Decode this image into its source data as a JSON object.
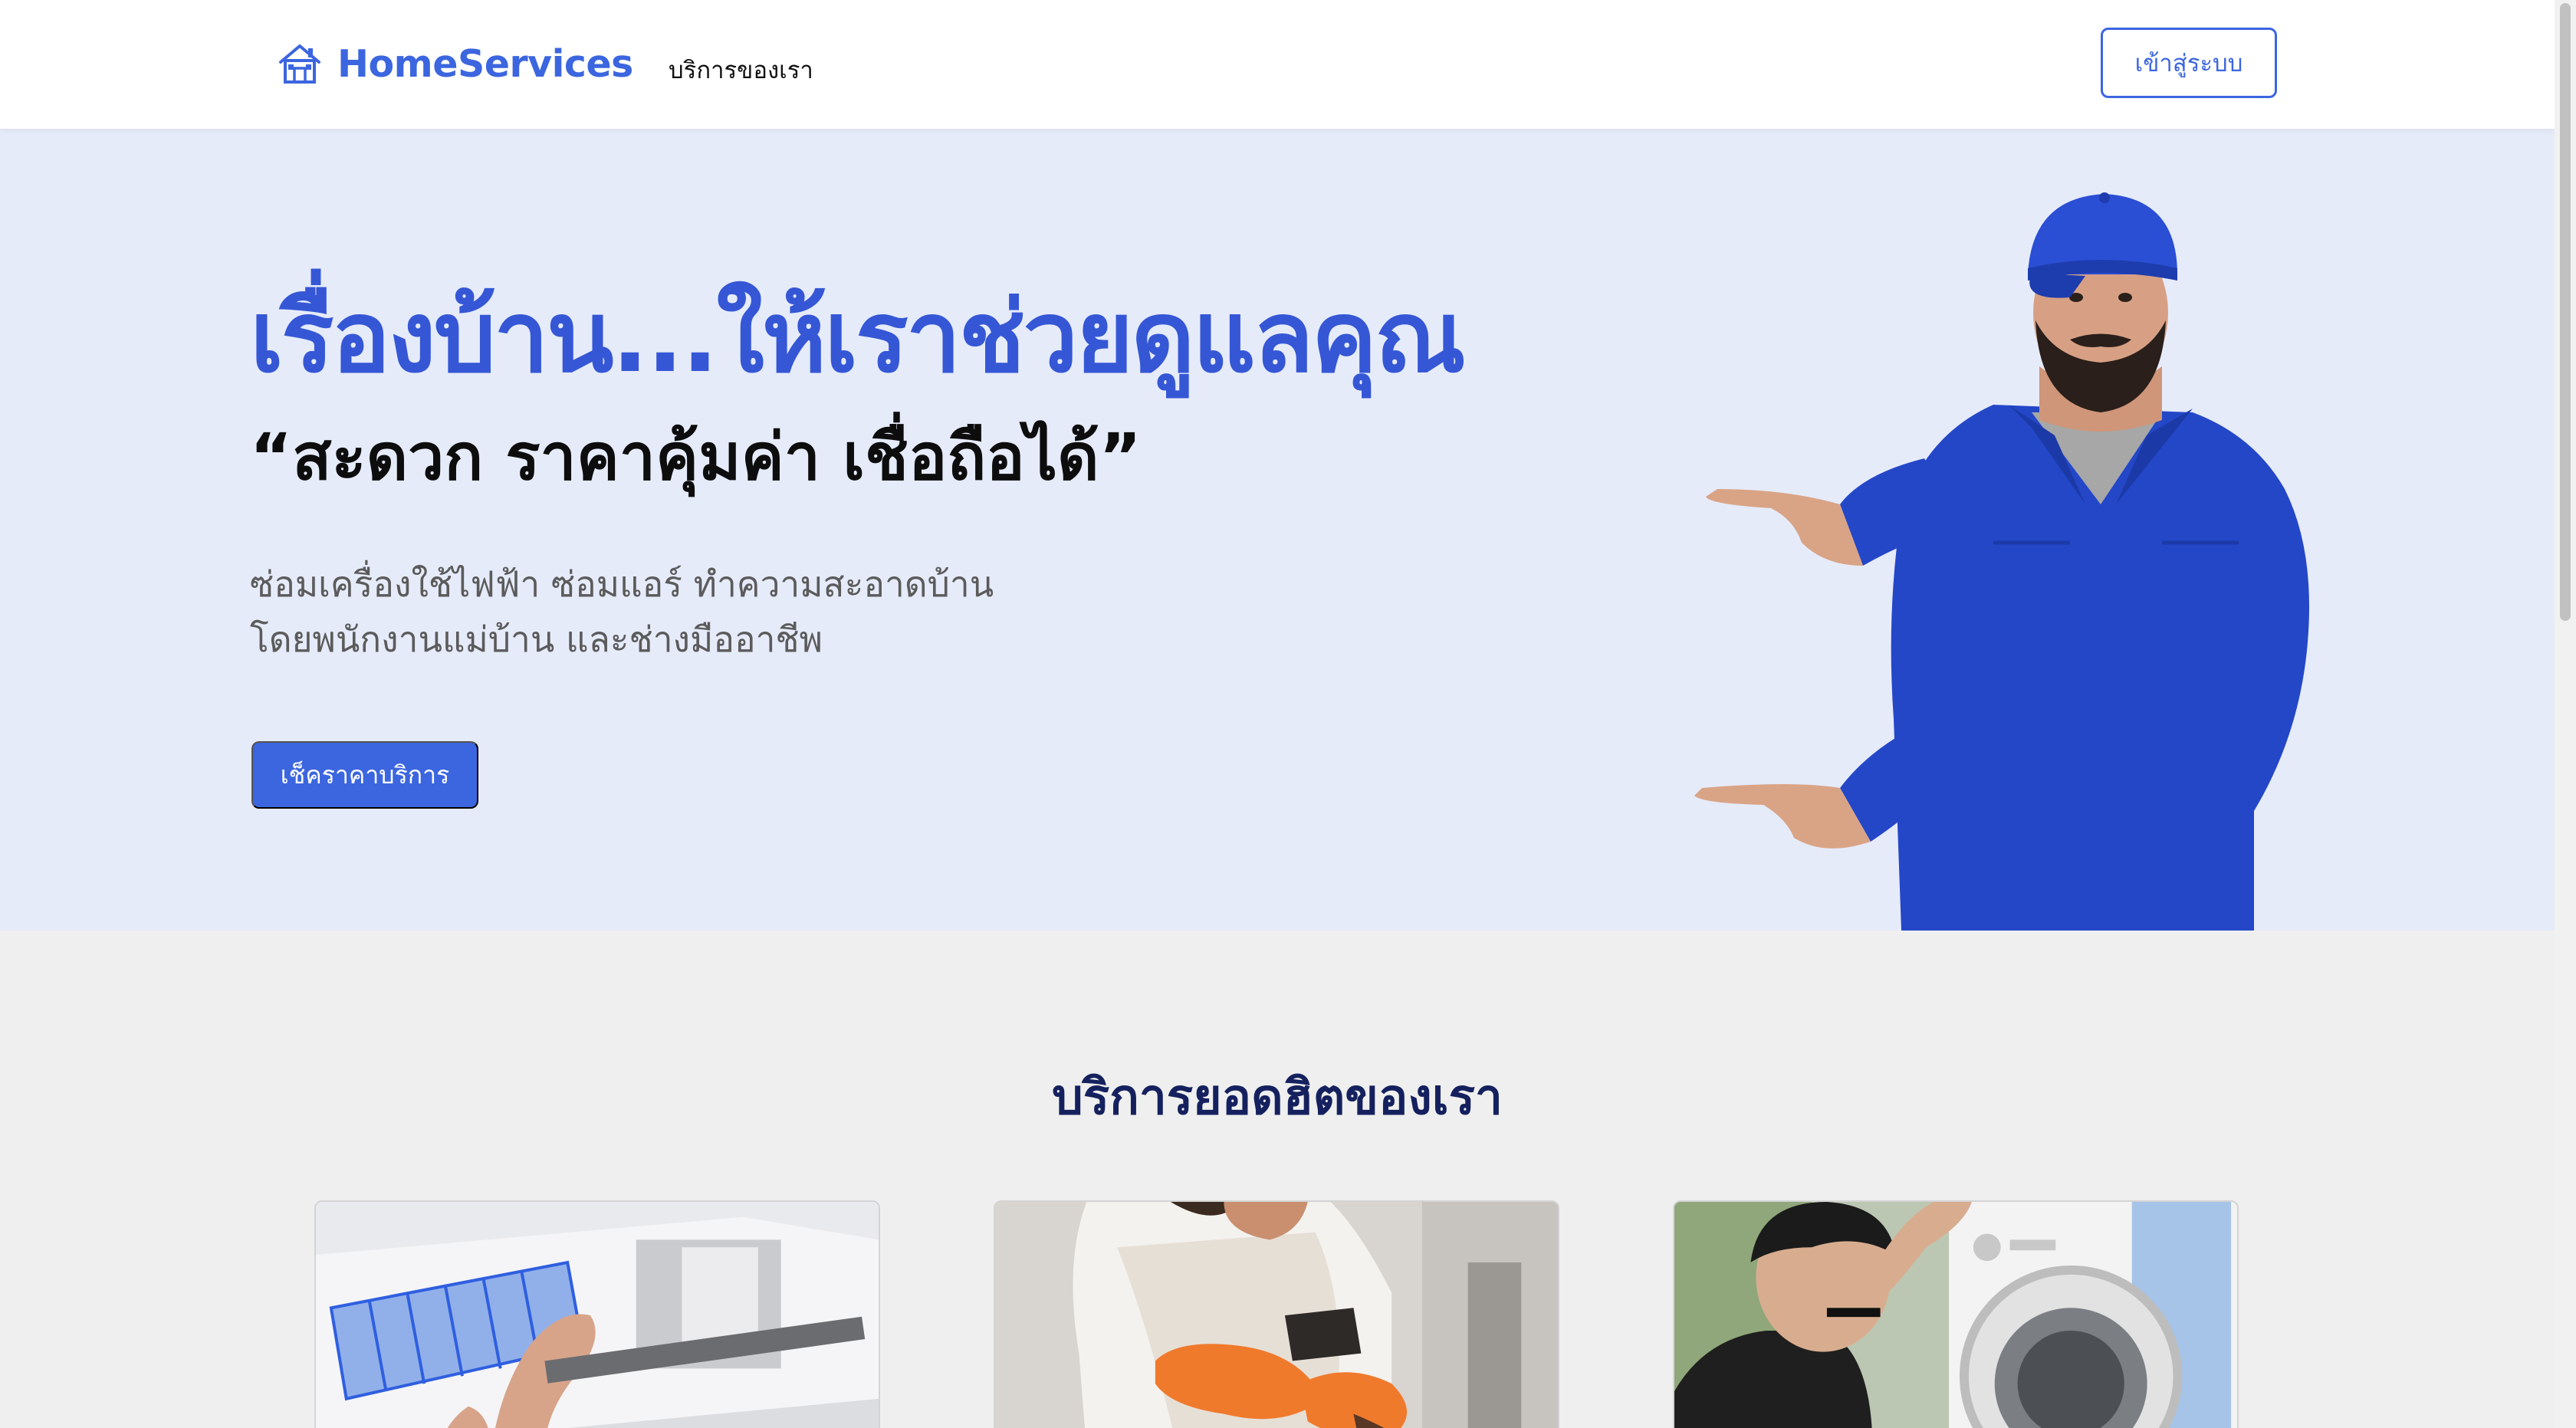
{
  "navbar": {
    "brand": "HomeServices",
    "brand_icon": "home-icon",
    "links": [
      "บริการของเรา"
    ],
    "login_label": "เข้าสู่ระบบ"
  },
  "hero": {
    "title": "เรื่องบ้าน...ให้เราช่วยดูแลคุณ",
    "subtitle": "“สะดวก ราคาคุ้มค่า เชื่อถือได้”",
    "description_line1": "ซ่อมเครื่องใช้ไฟฟ้า ซ่อมแอร์ ทำความสะอาดบ้าน",
    "description_line2": "โดยพนักงานแม่บ้าน และช่างมืออาชีพ",
    "cta_label": "เช็คราคาบริการ"
  },
  "services": {
    "heading": "บริการยอดฮิตของเรา",
    "cards": [
      {
        "image": "air-conditioner-filter-cleaning"
      },
      {
        "image": "house-cleaning-gloves"
      },
      {
        "image": "washing-machine-repair"
      }
    ]
  },
  "colors": {
    "primary": "#3c66df",
    "hero_bg": "#e6ebfa",
    "heading_dark": "#15215e",
    "page_bg": "#efefef"
  }
}
